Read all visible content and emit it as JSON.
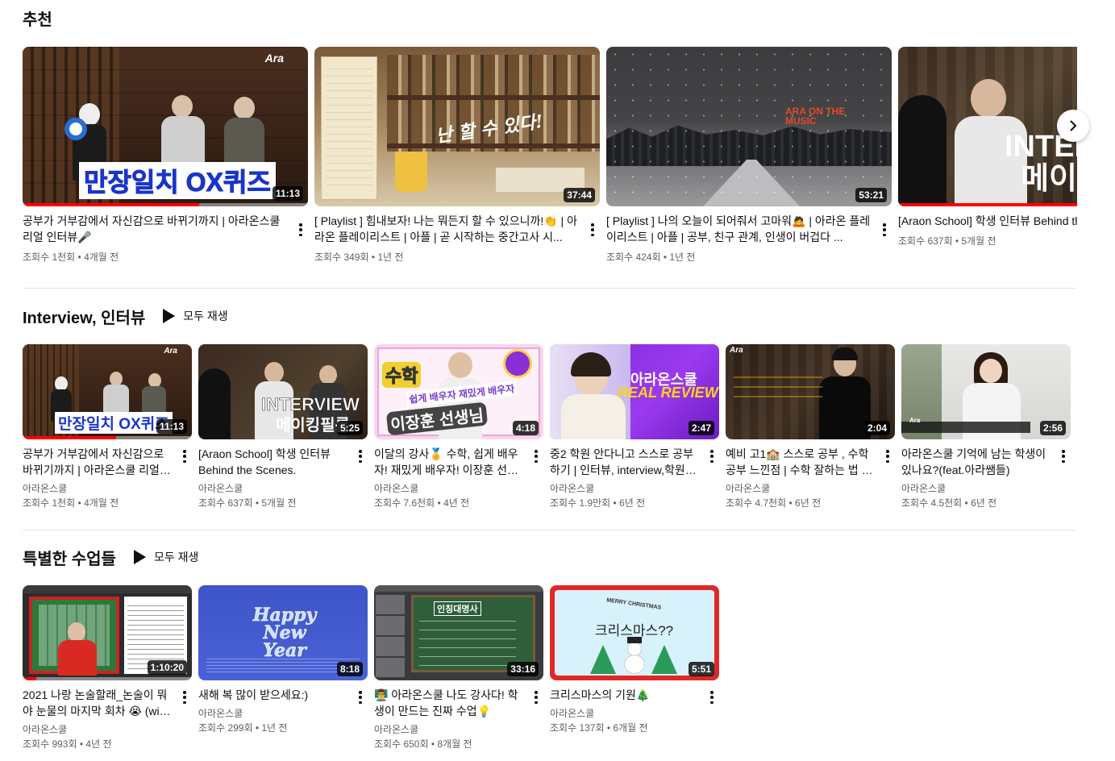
{
  "recommended": {
    "title": "추천",
    "videos": [
      {
        "title": "공부가 거부감에서 자신감으로 바뀌기까지 | 아라온스쿨 리얼 인터뷰🎤",
        "stats": "조회수 1천회 • 4개월 전",
        "duration": "11:13",
        "overlay": "만장일치 OX퀴즈",
        "logo": "Ara",
        "progress": 0.62
      },
      {
        "title": "[ Playlist ] 힘내보자! 나는 뭐든지 할 수 있으니까!👏 | 아라온 플레이리스트 | 아플 | 곧 시작하는 중간고사 시...",
        "stats": "조회수 349회 • 1년 전",
        "duration": "37:44",
        "overlay": "난 할 수 있다!"
      },
      {
        "title": "[ Playlist ] 나의 오늘이 되어줘서 고마워🙇 | 아라온 플레이리스트 | 아플 | 공부, 친구 관계, 인생이 버겁다 ...",
        "stats": "조회수 424회 • 1년 전",
        "duration": "53:21",
        "overlay": "ARA ON THE MUSIC"
      },
      {
        "title": "[Araon School] 학생 인터뷰 Behind the Scenes.",
        "stats": "조회수 637회 • 5개월 전",
        "overlay": "INTER 메이"
      }
    ]
  },
  "interview": {
    "title": "Interview, 인터뷰",
    "play_all": "모두 재생",
    "videos": [
      {
        "title": "공부가 거부감에서 자신감으로 바뀌기까지 | 아라온스쿨 리얼 인터뷰🎤",
        "channel": "아라온스쿨",
        "stats": "조회수 1천회 • 4개월 전",
        "duration": "11:13",
        "overlay": "만장일치 OX퀴즈",
        "logo": "Ara",
        "progress": 0.55
      },
      {
        "title": "[Araon School] 학생 인터뷰 Behind the Scenes.",
        "channel": "아라온스쿨",
        "stats": "조회수 637회 • 5개월 전",
        "duration": "5:25",
        "overlay": "INTERVIEW",
        "overlay2": "메이킹필름"
      },
      {
        "title": "이달의 강사🏅 수학, 쉽게 배우자! 재밌게 배우자! 이장훈 선생님",
        "channel": "아라온스쿨",
        "stats": "조회수 7.6천회 • 4년 전",
        "duration": "4:18",
        "overlay": "이장훈 선생님",
        "overlay2": "쉽게 배우자  재밌게 배우자",
        "overlay3": "수학"
      },
      {
        "title": "중2 학원 안다니고 스스로 공부하기 | 인터뷰, interview,학원 안다니고",
        "channel": "아라온스쿨",
        "stats": "조회수 1.9만회 • 6년 전",
        "duration": "2:47",
        "overlay": "아라온스쿨",
        "overlay2": "REAL REVIEW"
      },
      {
        "title": "예비 고1🏫 스스로 공부 , 수학 공부 느낀점 | 수학 잘하는 법 공부법",
        "channel": "아라온스쿨",
        "stats": "조회수 4.7천회 • 6년 전",
        "duration": "2:04",
        "logo": "Ara"
      },
      {
        "title": "아라온스쿨 기억에 남는 학생이 있나요?(feat.아라쌤들)",
        "channel": "아라온스쿨",
        "stats": "조회수 4.5천회 • 6년 전",
        "duration": "2:56",
        "logo": "Ara"
      }
    ]
  },
  "special": {
    "title": "특별한 수업들",
    "play_all": "모두 재생",
    "videos": [
      {
        "title": "2021 나랑 논술할래_논술이 뭐야 눈물의 마지막 회차 😭 (with 산타)",
        "channel": "아라온스쿨",
        "stats": "조회수 993회 • 4년 전",
        "duration": "1:10:20",
        "progress": 0.08
      },
      {
        "title": "새해 복 많이 받으세요:)",
        "channel": "아라온스쿨",
        "stats": "조회수 299회 • 1년 전",
        "duration": "8:18",
        "overlay": "Happy New Year"
      },
      {
        "title": "👨‍🏫 아라온스쿨 나도 강사다! 학생이 만드는 진짜 수업💡",
        "channel": "아라온스쿨",
        "stats": "조회수 650회 • 8개월 전",
        "duration": "33:16",
        "overlay": "인칭대명사"
      },
      {
        "title": "크리스마스의 기원🎄",
        "channel": "아라온스쿨",
        "stats": "조회수 137회 • 6개월 전",
        "duration": "5:51",
        "overlay": "크리스마스??",
        "overlay2": "MERRY CHRISTMAS"
      }
    ]
  }
}
